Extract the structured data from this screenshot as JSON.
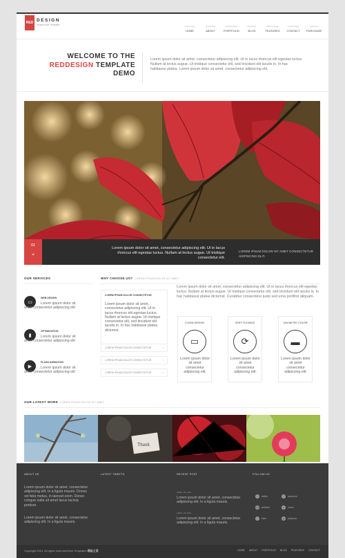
{
  "header": {
    "logo_mark": "RED",
    "logo_name": "DESIGN",
    "logo_tagline": "Responsive Template",
    "nav": [
      {
        "sub": "home blogs",
        "label": "HOME"
      },
      {
        "sub": "about blogs",
        "label": "ABOUT"
      },
      {
        "sub": "portfolio blogs",
        "label": "PORTFOLIO"
      },
      {
        "sub": "blog blogs",
        "label": "BLOG"
      },
      {
        "sub": "features blogs",
        "label": "FEATURES"
      },
      {
        "sub": "contact blogs",
        "label": "CONTACT"
      },
      {
        "sub": "purchase",
        "label": "PURCHASE"
      }
    ]
  },
  "welcome": {
    "line1": "WELCOME TO THE",
    "brand": "REDDESIGN",
    "line2": " TEMPLATE",
    "line3": "DEMO",
    "text": "Lorem ipsum dolor sit amet, consectetur adipiscing elit. Ut in lacus rhoncus elit egestas luctus. Nullam at lectus augue. Ut tristique consectetur elit, sed tincidunt elit iaculis in. In hac habitasse platea. Lorem ipsum dolor sit amet, consectetur adipiscing elit."
  },
  "slider": {
    "number": "01",
    "caption": "Lorem ipsum dolor sit amet, consectetur adipiscing elit. Ut in lacus rhoncus elit egestas luctus. Nullam at lectus augue. Ut tristique consectetur elit.",
    "side_text": "LOREM IPSUM DOLOR SIT AMET CONSECTETUR ADIPISCING ELIT."
  },
  "services": {
    "title": "OUR SERVICES",
    "items": [
      {
        "icon": "laptop-icon",
        "title": "WEB DESIGN",
        "text": "Lorem ipsum dolor sit amet consectetur adipiscing elit"
      },
      {
        "icon": "chart-icon",
        "title": "OPTIMIZATION",
        "text": "Lorem ipsum dolor sit amet consectetur adipiscing elit"
      },
      {
        "icon": "flash-icon",
        "title": "FLASH ANIMATION",
        "text": "Lorem ipsum dolor sit amet consectetur adipiscing elit"
      }
    ]
  },
  "why": {
    "title": "WHY CHOOSE US?",
    "subtitle": "LOREM IPSUM DOLOR SIT AMET",
    "accordion_open_title": "LOREM IPSUM DOLOR CONSECTETUR",
    "accordion_open_text": "Lorem ipsum dolor sit amet, consectetur adipiscing elit. Ut in lacus rhoncus elit egestas luctus. Nullam at lectus augue. Ut tristique consectetur elit, sed tincidunt elit iaculis in. In hac habitasse platea dictumst.",
    "accordion_items": [
      "LOREM IPSUM DOLOR CONSECTETUR",
      "LOREM IPSUM DOLOR CONSECTETUR",
      "LOREM IPSUM DOLOR CONSECTETUR"
    ],
    "text": "Lorem ipsum dolor sit amet, consectetur adipiscing elit. Ut in lacus rhoncus elit egestas luctus. Nullam at lectus augue. Ut tristique consectetur elit, sed tincidunt elit iaculis in. In hac habitasse platea dictumst. Curabitur consectetur justo sed urna porttitor aliquam.",
    "features": [
      {
        "title": "CLEAN DESIGN",
        "icon": "monitor-icon",
        "text": "Lorem ipsum dolor sit amet consectetur adipiscing elit."
      },
      {
        "title": "VERY FLEXIBLE",
        "icon": "refresh-icon",
        "text": "Lorem ipsum dolor sit amet consectetur adipiscing elit."
      },
      {
        "title": "UNLIMITED COLOR",
        "icon": "paint-roller-icon",
        "text": "Lorem ipsum dolor sit amet consectetur adipiscing elit."
      }
    ]
  },
  "work": {
    "title": "OUR LATEST WORK",
    "subtitle": "LOREM IPSUM DOLOR SIT AMET"
  },
  "footer": {
    "about_title": "ABOUT US",
    "about_text1": "Lorem ipsum dolor sit amet, consectetur adipiscing elit. In a ligula mauris. Donec vel felis metus, in laoreet enim. Donec congue nulla sit amet lacus lacinia pretium.",
    "about_text2": "Lorem ipsum dolor sit amet, consectetur adipiscing elit. In a ligula mauris.",
    "tweets_title": "LATEST TWEETS",
    "post_title": "RECENT POST",
    "posts": [
      {
        "date": "APRIL 18, 2013",
        "text": "Lorem ipsum dolor sit amet, consectetur adipiscing elit. In a ligula mauris."
      },
      {
        "date": "APRIL 18, 2013",
        "text": "Lorem ipsum dolor sit amet, consectetur adipiscing elit. In a ligula mauris."
      }
    ],
    "follow_title": "FOLLOW US",
    "social": [
      {
        "icon": "twitter-icon",
        "label": "twitter"
      },
      {
        "icon": "facebook-icon",
        "label": "facebook"
      },
      {
        "icon": "dribbble-icon",
        "label": "dribbble"
      },
      {
        "icon": "vimeo-icon",
        "label": "vimeo"
      },
      {
        "icon": "flickr-icon",
        "label": "flickr"
      },
      {
        "icon": "pinterest-icon",
        "label": "pinterest"
      }
    ],
    "copyright": "Copyright 2013. All rights reserved.More Templates",
    "copyright_brand": "模板之家",
    "nav": [
      "HOME",
      "ABOUT",
      "PORTFOLIO",
      "BLOG",
      "FEATURES",
      "CONTACT"
    ]
  },
  "colors": {
    "accent": "#d64541",
    "dark": "#2d2d2d",
    "footer": "#3b3b3b"
  }
}
